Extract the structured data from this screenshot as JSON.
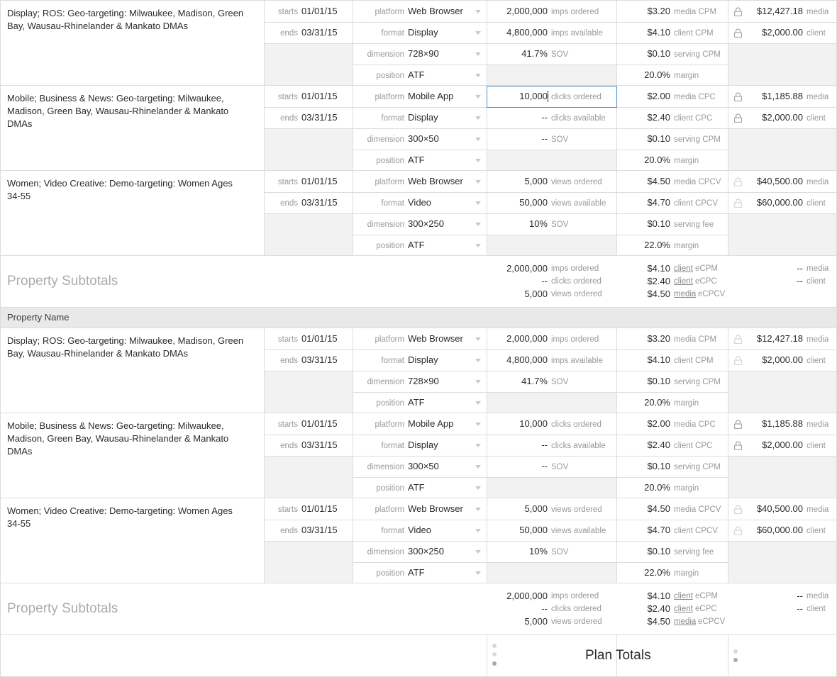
{
  "sections": [
    {
      "items": [
        {
          "name": "Display; ROS: Geo-targeting: Milwaukee, Madison, Green Bay, Wausau-Rhinelander & Mankato DMAs",
          "starts_label": "starts",
          "starts": "01/01/15",
          "ends_label": "ends",
          "ends": "03/31/15",
          "platform_label": "platform",
          "platform": "Web Browser",
          "format_label": "format",
          "format": "Display",
          "dimension_label": "dimension",
          "dimension": "728×90",
          "position_label": "position",
          "position": "ATF",
          "m1": "2,000,000",
          "m1_label": "imps ordered",
          "m2": "4,800,000",
          "m2_label": "imps available",
          "m3": "41.7%",
          "m3_label": "SOV",
          "r1": "$3.20",
          "r1_label": "media CPM",
          "r2": "$4.10",
          "r2_label": "client CPM",
          "r3": "$0.10",
          "r3_label": "serving CPM",
          "r4": "20.0%",
          "r4_label": "margin",
          "t1": "$12,427.18",
          "t1_label": "media",
          "t2": "$2,000.00",
          "t2_label": "client",
          "editing": false
        },
        {
          "name": "Mobile; Business & News: Geo-targeting: Milwaukee, Madison, Green Bay, Wausau-Rhinelander & Mankato DMAs",
          "starts_label": "starts",
          "starts": "01/01/15",
          "ends_label": "ends",
          "ends": "03/31/15",
          "platform_label": "platform",
          "platform": "Mobile App",
          "format_label": "format",
          "format": "Display",
          "dimension_label": "dimension",
          "dimension": "300×50",
          "position_label": "position",
          "position": "ATF",
          "m1": "10,000",
          "m1_label": "clicks ordered",
          "m2": "--",
          "m2_label": "clicks available",
          "m3": "--",
          "m3_label": "SOV",
          "r1": "$2.00",
          "r1_label": "media CPC",
          "r2": "$2.40",
          "r2_label": "client CPC",
          "r3": "$0.10",
          "r3_label": "serving CPM",
          "r4": "20.0%",
          "r4_label": "margin",
          "t1": "$1,185.88",
          "t1_label": "media",
          "t2": "$2,000.00",
          "t2_label": "client",
          "editing": true
        },
        {
          "name": "Women; Video Creative: Demo-targeting: Women Ages 34-55",
          "starts_label": "starts",
          "starts": "01/01/15",
          "ends_label": "ends",
          "ends": "03/31/15",
          "platform_label": "platform",
          "platform": "Web Browser",
          "format_label": "format",
          "format": "Video",
          "dimension_label": "dimension",
          "dimension": "300×250",
          "position_label": "position",
          "position": "ATF",
          "m1": "5,000",
          "m1_label": "views ordered",
          "m2": "50,000",
          "m2_label": "views available",
          "m3": "10%",
          "m3_label": "SOV",
          "r1": "$4.50",
          "r1_label": "media CPCV",
          "r2": "$4.70",
          "r2_label": "client CPCV",
          "r3": "$0.10",
          "r3_label": "serving fee",
          "r4": "22.0%",
          "r4_label": "margin",
          "t1": "$40,500.00",
          "t1_label": "media",
          "t2": "$60,000.00",
          "t2_label": "client",
          "editing": false
        }
      ],
      "subtotal": {
        "title": "Property Subtotals",
        "rows": [
          {
            "v": "2,000,000",
            "l": "imps ordered",
            "rv": "$4.10",
            "rl_link": "client",
            "rl": "eCPM",
            "tv": "--",
            "tl": "media"
          },
          {
            "v": "--",
            "l": "clicks ordered",
            "rv": "$2.40",
            "rl_link": "client",
            "rl": "eCPC",
            "tv": "--",
            "tl": "client"
          },
          {
            "v": "5,000",
            "l": "views ordered",
            "rv": "$4.50",
            "rl_link": "media",
            "rl": "eCPCV",
            "tv": "",
            "tl": ""
          }
        ]
      }
    },
    {
      "header": "Property Name",
      "items": [
        {
          "name": "Display; ROS: Geo-targeting: Milwaukee, Madison, Green Bay, Wausau-Rhinelander & Mankato DMAs",
          "starts_label": "starts",
          "starts": "01/01/15",
          "ends_label": "ends",
          "ends": "03/31/15",
          "platform_label": "platform",
          "platform": "Web Browser",
          "format_label": "format",
          "format": "Display",
          "dimension_label": "dimension",
          "dimension": "728×90",
          "position_label": "position",
          "position": "ATF",
          "m1": "2,000,000",
          "m1_label": "imps ordered",
          "m2": "4,800,000",
          "m2_label": "imps available",
          "m3": "41.7%",
          "m3_label": "SOV",
          "r1": "$3.20",
          "r1_label": "media CPM",
          "r2": "$4.10",
          "r2_label": "client CPM",
          "r3": "$0.10",
          "r3_label": "serving CPM",
          "r4": "20.0%",
          "r4_label": "margin",
          "t1": "$12,427.18",
          "t1_label": "media",
          "t2": "$2,000.00",
          "t2_label": "client",
          "editing": false
        },
        {
          "name": "Mobile; Business & News: Geo-targeting: Milwaukee, Madison, Green Bay, Wausau-Rhinelander & Mankato DMAs",
          "starts_label": "starts",
          "starts": "01/01/15",
          "ends_label": "ends",
          "ends": "03/31/15",
          "platform_label": "platform",
          "platform": "Mobile App",
          "format_label": "format",
          "format": "Display",
          "dimension_label": "dimension",
          "dimension": "300×50",
          "position_label": "position",
          "position": "ATF",
          "m1": "10,000",
          "m1_label": "clicks ordered",
          "m2": "--",
          "m2_label": "clicks available",
          "m3": "--",
          "m3_label": "SOV",
          "r1": "$2.00",
          "r1_label": "media CPC",
          "r2": "$2.40",
          "r2_label": "client CPC",
          "r3": "$0.10",
          "r3_label": "serving CPM",
          "r4": "20.0%",
          "r4_label": "margin",
          "t1": "$1,185.88",
          "t1_label": "media",
          "t2": "$2,000.00",
          "t2_label": "client",
          "editing": false
        },
        {
          "name": "Women; Video Creative: Demo-targeting: Women Ages 34-55",
          "starts_label": "starts",
          "starts": "01/01/15",
          "ends_label": "ends",
          "ends": "03/31/15",
          "platform_label": "platform",
          "platform": "Web Browser",
          "format_label": "format",
          "format": "Video",
          "dimension_label": "dimension",
          "dimension": "300×250",
          "position_label": "position",
          "position": "ATF",
          "m1": "5,000",
          "m1_label": "views ordered",
          "m2": "50,000",
          "m2_label": "views available",
          "m3": "10%",
          "m3_label": "SOV",
          "r1": "$4.50",
          "r1_label": "media CPCV",
          "r2": "$4.70",
          "r2_label": "client CPCV",
          "r3": "$0.10",
          "r3_label": "serving fee",
          "r4": "22.0%",
          "r4_label": "margin",
          "t1": "$40,500.00",
          "t1_label": "media",
          "t2": "$60,000.00",
          "t2_label": "client",
          "editing": false
        }
      ],
      "subtotal": {
        "title": "Property Subtotals",
        "rows": [
          {
            "v": "2,000,000",
            "l": "imps ordered",
            "rv": "$4.10",
            "rl_link": "client",
            "rl": "eCPM",
            "tv": "--",
            "tl": "media"
          },
          {
            "v": "--",
            "l": "clicks ordered",
            "rv": "$2.40",
            "rl_link": "client",
            "rl": "eCPC",
            "tv": "--",
            "tl": "client"
          },
          {
            "v": "5,000",
            "l": "views ordered",
            "rv": "$4.50",
            "rl_link": "media",
            "rl": "eCPCV",
            "tv": "",
            "tl": ""
          }
        ]
      }
    }
  ],
  "plan_totals": {
    "title": "Plan Totals"
  },
  "colors": {
    "grid_line": "#dcdcdc",
    "disabled_cell": "#f1f2f1",
    "section_header": "#e7e9ea",
    "input_focus": "#4a90c8",
    "muted_text": "#999999"
  },
  "icons": [
    "lock-icon",
    "chevron-down-icon",
    "scroll-dots-icon"
  ]
}
